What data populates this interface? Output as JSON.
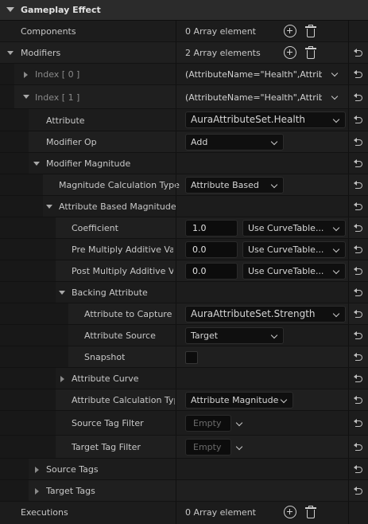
{
  "section": {
    "title": "Gameplay Effect"
  },
  "components": {
    "label": "Components",
    "value": "0 Array element"
  },
  "modifiers": {
    "label": "Modifiers",
    "value": "2 Array elements"
  },
  "index0": {
    "label": "Index [ 0 ]",
    "value": "(AttributeName=\"Health\",Attribut"
  },
  "index1": {
    "label": "Index [ 1 ]",
    "value": "(AttributeName=\"Health\",Attribut"
  },
  "attribute": {
    "label": "Attribute",
    "value": "AuraAttributeSet.Health"
  },
  "modifier_op": {
    "label": "Modifier Op",
    "value": "Add"
  },
  "modifier_magnitude": {
    "label": "Modifier Magnitude"
  },
  "magnitude_calc_type": {
    "label": "Magnitude Calculation Type",
    "value": "Attribute Based"
  },
  "attribute_based_magnitude": {
    "label": "Attribute Based Magnitude"
  },
  "coefficient": {
    "label": "Coefficient",
    "value": "1.0",
    "curve": "Use CurveTable..."
  },
  "pre_multiply": {
    "label": "Pre Multiply Additive Va",
    "value": "0.0",
    "curve": "Use CurveTable..."
  },
  "post_multiply": {
    "label": "Post Multiply Additive V",
    "value": "0.0",
    "curve": "Use CurveTable..."
  },
  "backing_attribute": {
    "label": "Backing Attribute"
  },
  "attribute_to_capture": {
    "label": "Attribute to Capture",
    "value": "AuraAttributeSet.Strength"
  },
  "attribute_source": {
    "label": "Attribute Source",
    "value": "Target"
  },
  "snapshot": {
    "label": "Snapshot",
    "checked": false
  },
  "attribute_curve": {
    "label": "Attribute Curve"
  },
  "attribute_calc_type": {
    "label": "Attribute Calculation Type",
    "value": "Attribute Magnitude"
  },
  "source_tag_filter": {
    "label": "Source Tag Filter",
    "value": "Empty"
  },
  "target_tag_filter": {
    "label": "Target Tag Filter",
    "value": "Empty"
  },
  "source_tags": {
    "label": "Source Tags"
  },
  "target_tags": {
    "label": "Target Tags"
  },
  "executions": {
    "label": "Executions",
    "value": "0 Array element"
  }
}
